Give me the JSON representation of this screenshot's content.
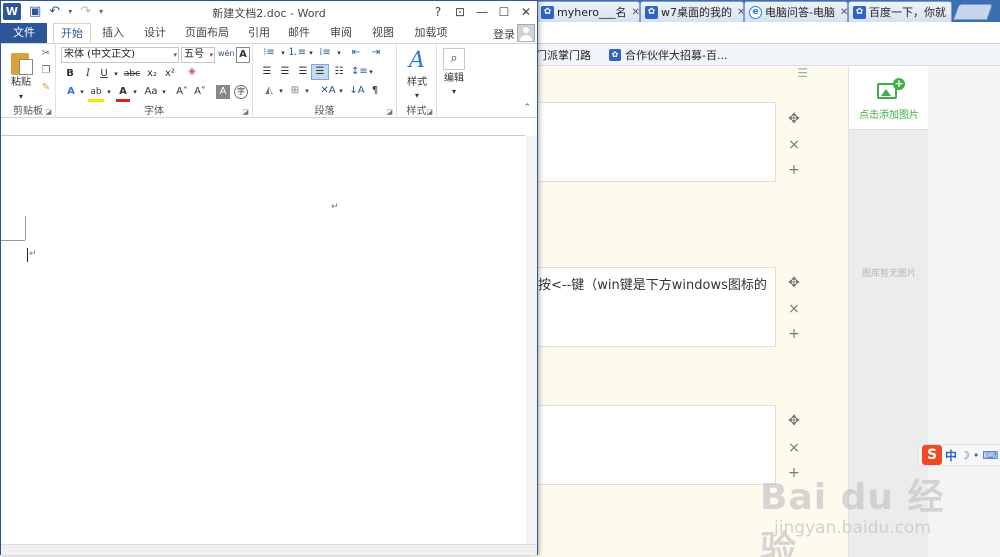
{
  "browser": {
    "tabs": [
      {
        "label": "myhero___名",
        "icon": "paw-icon"
      },
      {
        "label": "w7桌面的我的",
        "icon": "paw-icon"
      },
      {
        "label": "电脑问答-电脑",
        "icon": "ie-icon"
      },
      {
        "label": "百度一下，你就",
        "icon": "paw-icon"
      }
    ],
    "bookmarks": [
      {
        "label": "门派掌门路"
      },
      {
        "label": "合作伙伴大招募-百..."
      }
    ]
  },
  "editor": {
    "steps": [
      {
        "text": ""
      },
      {
        "text": "按<--键（win键是下方windows图标的"
      },
      {
        "text": ""
      }
    ],
    "controls": {
      "move": "✥",
      "remove": "×",
      "add": "+"
    }
  },
  "right_panel": {
    "add_image_label": "点击添加图片",
    "empty_label": "图库暂无图片"
  },
  "ime": {
    "logo": "S",
    "mode": "中",
    "moon": "☽",
    "dot": "•",
    "keyboard": "⌨"
  },
  "watermark": {
    "main": "Bai du 经验",
    "sub": "jingyan.baidu.com"
  },
  "word": {
    "title": "新建文档2.doc - Word",
    "logo": "W",
    "qat": {
      "save": "▣",
      "undo": "↶",
      "redo": "↷",
      "more": "▾"
    },
    "window_controls": {
      "help": "?",
      "restore_ribbon": "⊡",
      "minimize": "—",
      "maximize": "☐",
      "close": "✕"
    },
    "tabs": {
      "file": "文件",
      "items": [
        "开始",
        "插入",
        "设计",
        "页面布局",
        "引用",
        "邮件",
        "审阅",
        "视图",
        "加载项"
      ]
    },
    "signin": "登录",
    "ribbon": {
      "clipboard": {
        "label": "剪贴板",
        "paste": "粘贴"
      },
      "font": {
        "label": "字体",
        "font_name": "宋体 (中文正文)",
        "font_size": "五号",
        "wen": "wén",
        "big_a": "A",
        "bold": "B",
        "italic": "I",
        "underline": "U",
        "strike": "abc",
        "sub": "x₂",
        "sup": "x²",
        "text_effect": "A",
        "highlight": "ab",
        "font_color": "A",
        "case": "Aa",
        "grow": "A˄",
        "shrink": "A˅",
        "border_a": "A",
        "enclose": "字"
      },
      "paragraph": {
        "label": "段落"
      },
      "styles": {
        "label": "样式",
        "styles_button": "样式"
      },
      "editing": {
        "label": "",
        "editing_button": "编辑"
      }
    }
  }
}
